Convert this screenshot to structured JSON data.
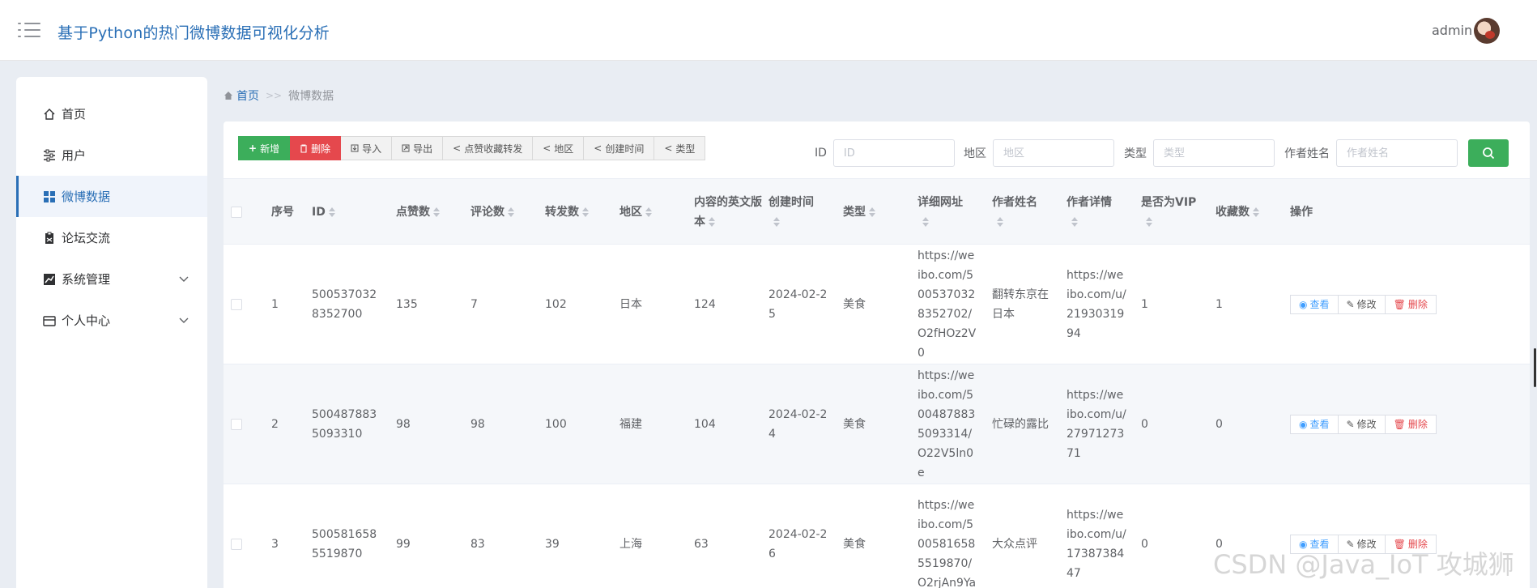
{
  "header": {
    "title": "基于Python的热门微博数据可视化分析",
    "user": "admin"
  },
  "sidebar": {
    "items": [
      {
        "label": "首页",
        "icon": "home-icon"
      },
      {
        "label": "用户",
        "icon": "sliders-icon"
      },
      {
        "label": "微博数据",
        "icon": "grid-icon",
        "active": true
      },
      {
        "label": "论坛交流",
        "icon": "clipboard-icon"
      },
      {
        "label": "系统管理",
        "icon": "chart-icon",
        "expandable": true
      },
      {
        "label": "个人中心",
        "icon": "card-icon",
        "expandable": true
      }
    ]
  },
  "breadcrumb": {
    "home": "首页",
    "sep": ">>",
    "current": "微博数据"
  },
  "toolbar": {
    "add": "新增",
    "delete": "删除",
    "import": "导入",
    "export": "导出",
    "stat_likes": "点赞收藏转发",
    "stat_region": "地区",
    "stat_time": "创建时间",
    "stat_type": "类型"
  },
  "search": {
    "id_label": "ID",
    "id_placeholder": "ID",
    "region_label": "地区",
    "region_placeholder": "地区",
    "type_label": "类型",
    "type_placeholder": "类型",
    "author_label": "作者姓名",
    "author_placeholder": "作者姓名"
  },
  "table": {
    "headers": {
      "idx": "序号",
      "id": "ID",
      "likes": "点赞数",
      "comments": "评论数",
      "reposts": "转发数",
      "region": "地区",
      "en_version": "内容的英文版本",
      "created": "创建时间",
      "type": "类型",
      "url": "详细网址",
      "author": "作者姓名",
      "author_detail": "作者详情",
      "vip": "是否为VIP",
      "favorites": "收藏数",
      "ops": "操作"
    },
    "actions": {
      "view": "查看",
      "edit": "修改",
      "delete": "删除"
    },
    "rows": [
      {
        "idx": "1",
        "id": "5005370328352700",
        "likes": "135",
        "comments": "7",
        "reposts": "102",
        "region": "日本",
        "en_version": "124",
        "created": "2024-02-25",
        "type": "美食",
        "url": "https://weibo.com/5005370328352702/O2fHOz2V0",
        "author": "翻转东京在日本",
        "author_detail": "https://weibo.com/u/2193031994",
        "vip": "1",
        "favorites": "1"
      },
      {
        "idx": "2",
        "id": "5004878835093310",
        "likes": "98",
        "comments": "98",
        "reposts": "100",
        "region": "福建",
        "en_version": "104",
        "created": "2024-02-24",
        "type": "美食",
        "url": "https://weibo.com/5004878835093314/O22V5ln0e",
        "author": "忙碌的露比",
        "author_detail": "https://weibo.com/u/2797127371",
        "vip": "0",
        "favorites": "0"
      },
      {
        "idx": "3",
        "id": "5005816585519870",
        "likes": "99",
        "comments": "83",
        "reposts": "39",
        "region": "上海",
        "en_version": "63",
        "created": "2024-02-26",
        "type": "美食",
        "url": "https://weibo.com/5005816585519870/O2rjAn9Ya",
        "author": "大众点评",
        "author_detail": "https://weibo.com/u/1738738447",
        "vip": "0",
        "favorites": "0"
      }
    ]
  },
  "watermark": "CSDN @Java_IoT 攻城狮",
  "colors": {
    "primary": "#2a6fb6",
    "success": "#3cae5b",
    "danger": "#e5484d"
  }
}
